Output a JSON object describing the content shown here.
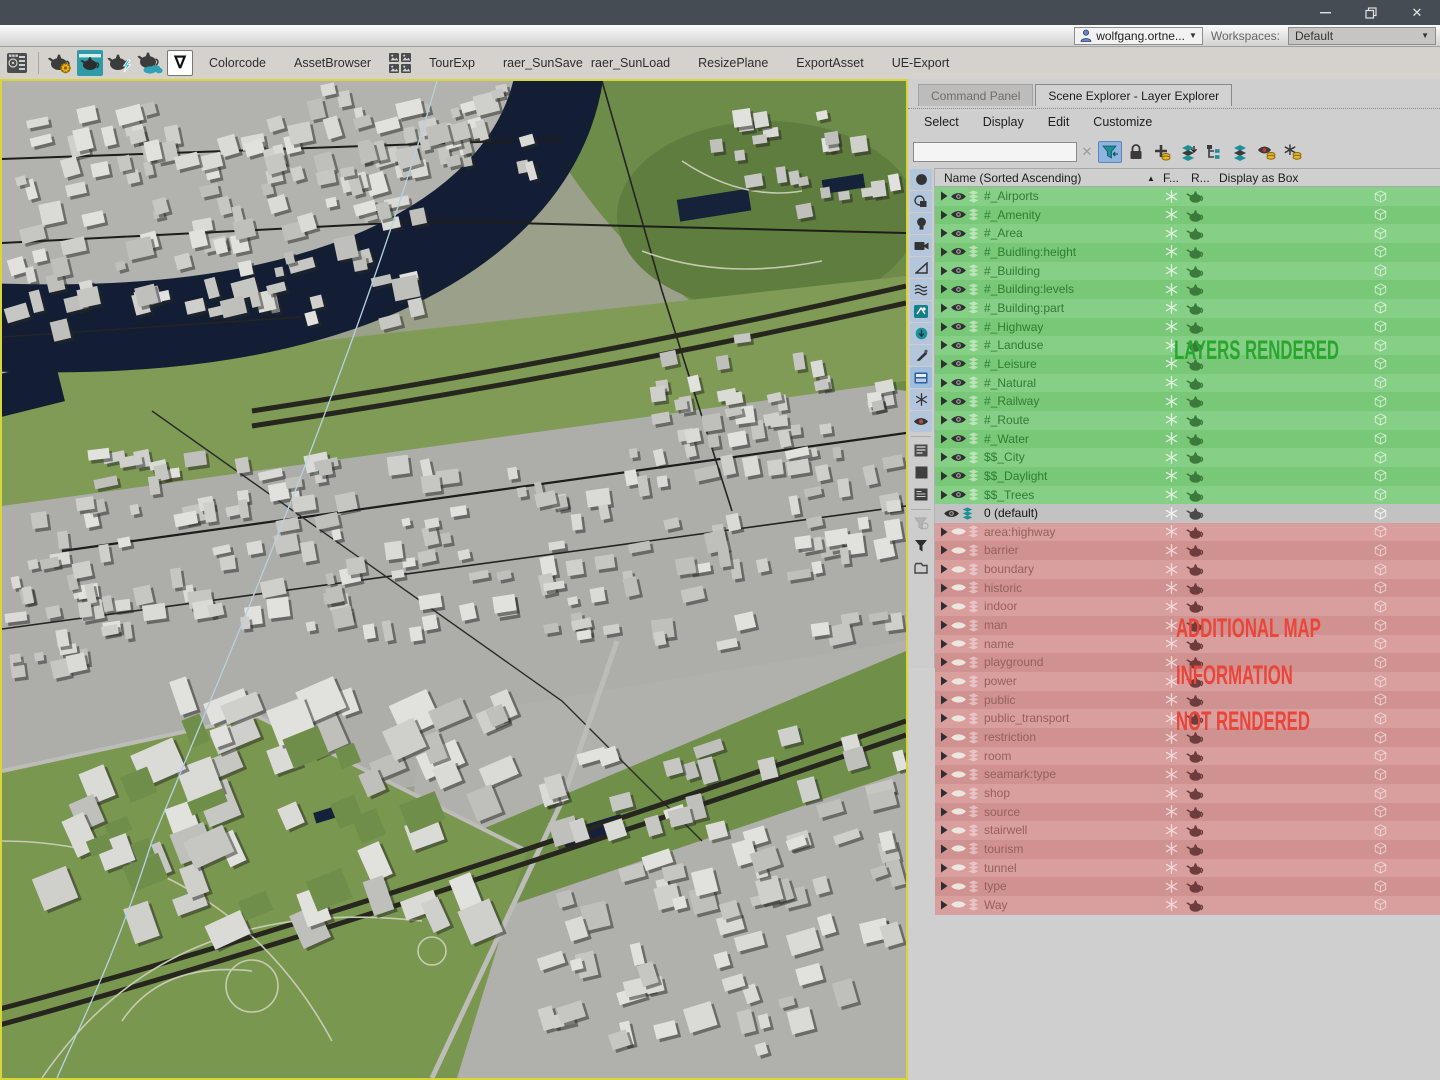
{
  "titlebar": {
    "minimize_label": "minimize",
    "restore_label": "restore",
    "close_label": "close"
  },
  "account_bar": {
    "user": "wolfgang.ortne...",
    "workspaces_label": "Workspaces:",
    "workspace_value": "Default"
  },
  "main_toolbar": {
    "icons": [
      "workspace-panel-icon",
      "render-setup-teapot-icon",
      "rendered-frame-window-teapot-icon",
      "render-iterative-teapot-icon",
      "render-cloud-teapot-icon",
      "gradient-nabla-icon",
      "asset-grid-icon"
    ],
    "nabla_glyph": "∇",
    "buttons": [
      "Colorcode",
      "AssetBrowser",
      "TourExp",
      "raer_SunSave",
      "raer_SunLoad",
      "ResizePlane",
      "ExportAsset",
      "UE-Export"
    ]
  },
  "explorer": {
    "tabs": {
      "inactive": "Command Panel",
      "active": "Scene Explorer - Layer Explorer"
    },
    "menu": [
      "Select",
      "Display",
      "Edit",
      "Customize"
    ],
    "search_value": "",
    "toolbar_icons": [
      "clear-search-icon",
      "filter-icon",
      "lock-cell-editing-icon",
      "create-new-layer-icon",
      "add-to-layer-icon",
      "layer-hierarchy-icon",
      "collapse-layers-icon",
      "hide-category-icon",
      "freeze-category-icon"
    ],
    "side_icons": [
      "display-geometry-icon",
      "display-shapes-icon",
      "display-lights-icon",
      "display-cameras-icon",
      "display-helpers-icon",
      "display-spacewarps-icon",
      "display-systems-icon",
      "display-bones-icon",
      "display-particles-icon",
      "display-frozen-icon",
      "display-snowflake-icon",
      "display-visibility-icon",
      "list-view-icon",
      "solid-fill-icon",
      "detail-view-icon",
      "filter-disabled-icon",
      "filter-funnel-icon",
      "collect-icon"
    ],
    "columns": {
      "name": "Name (Sorted Ascending)",
      "sort_indicator": "▲",
      "frozen": "F...",
      "render": "R...",
      "display_as_box": "Display as Box"
    },
    "layers_rendered": [
      "#_Airports",
      "#_Amenity",
      "#_Area",
      "#_Buidling:height",
      "#_Building",
      "#_Building:levels",
      "#_Building:part",
      "#_Highway",
      "#_Landuse",
      "#_Leisure",
      "#_Natural",
      "#_Railway",
      "#_Route",
      "#_Water",
      "$$_City",
      "$$_Daylight",
      "$$_Trees"
    ],
    "default_layer": "0 (default)",
    "layers_hidden": [
      "area:highway",
      "barrier",
      "boundary",
      "historic",
      "indoor",
      "man",
      "name",
      "playground",
      "power",
      "public",
      "public_transport",
      "restriction",
      "room",
      "seamark:type",
      "shop",
      "source",
      "stairwell",
      "tourism",
      "tunnel",
      "type",
      "Way"
    ],
    "annotations": {
      "rendered": "LAYERS RENDERED",
      "hidden_line1": "ADDITIONAL MAP",
      "hidden_line2": "INFORMATION",
      "hidden_line3": "NOT RENDERED"
    },
    "colors": {
      "rendered_row": "#80cc80",
      "hidden_row": "#d49898",
      "active_row": "#c2c2c2",
      "annotation_green": "#2aa62e",
      "annotation_red": "#ea4539",
      "viewport_border": "#d9d437",
      "river": "#131e35"
    }
  }
}
